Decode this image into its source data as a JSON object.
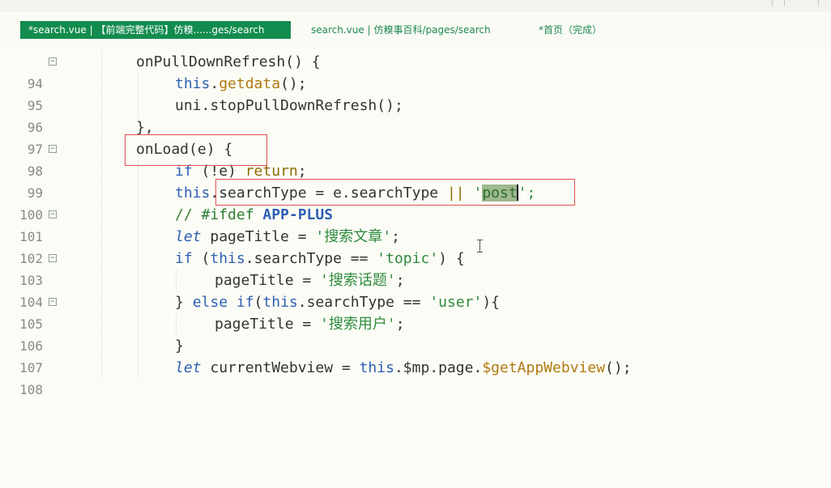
{
  "editor": {
    "tabs": [
      {
        "label": "*search.vue | 【前端完整代码】仿糗......ges/search",
        "active": true
      },
      {
        "label": "search.vue | 仿糗事百科/pages/search",
        "active": false
      },
      {
        "label": "*首页（完成）",
        "active": false
      }
    ],
    "active_tab_color": "#128c4e",
    "highlight_box_color": "#e05050",
    "lines": [
      {
        "num": "94",
        "fold": true
      },
      {
        "num": "95",
        "fold": false
      },
      {
        "num": "96",
        "fold": false
      },
      {
        "num": "97",
        "fold": false
      },
      {
        "num": "98",
        "fold": true
      },
      {
        "num": "99",
        "fold": false
      },
      {
        "num": "100",
        "fold": false
      },
      {
        "num": "101",
        "fold": true
      },
      {
        "num": "102",
        "fold": false
      },
      {
        "num": "103",
        "fold": true
      },
      {
        "num": "104",
        "fold": false
      },
      {
        "num": "105",
        "fold": true
      },
      {
        "num": "106",
        "fold": false
      },
      {
        "num": "107",
        "fold": false
      },
      {
        "num": "108",
        "fold": false
      }
    ],
    "code": {
      "l94": {
        "a": "onPullDownRefresh() {"
      },
      "l95": {
        "a": "this",
        "b": ".",
        "c": "getdata",
        "d": "();"
      },
      "l96": {
        "a": "uni.",
        "b": "stopPullDownRefresh",
        "c": "();"
      },
      "l97": {
        "a": "},"
      },
      "l98": {
        "a": "onLoad(e) {"
      },
      "l99": {
        "a": "if",
        "b": " (!e) ",
        "c": "return",
        "d": ";"
      },
      "l100": {
        "a": "this",
        "b": ".searchType = e.searchType ",
        "c": "||",
        "d": " '",
        "e": "post",
        "f": "';"
      },
      "l101": {
        "a": "// #ifdef ",
        "b": "APP-PLUS"
      },
      "l102": {
        "a": "let",
        "b": " pageTitle = ",
        "c": "'搜索文章'",
        "d": ";"
      },
      "l103": {
        "a": "if",
        "b": " (",
        "c": "this",
        "d": ".searchType == ",
        "e": "'topic'",
        "f": ") {"
      },
      "l104": {
        "a": "pageTitle = ",
        "b": "'搜索话题'",
        "c": ";"
      },
      "l105": {
        "a": "} ",
        "b": "else if",
        "c": "(",
        "d": "this",
        "e": ".searchType == ",
        "f": "'user'",
        "g": "){"
      },
      "l106": {
        "a": "pageTitle = ",
        "b": "'搜索用户'",
        "c": ";"
      },
      "l107": {
        "a": "}"
      },
      "l108": {
        "a": "let",
        "b": " currentWebview = ",
        "c": "this",
        "d": ".$mp.page.",
        "e": "$getAppWebview",
        "f": "();"
      }
    }
  }
}
